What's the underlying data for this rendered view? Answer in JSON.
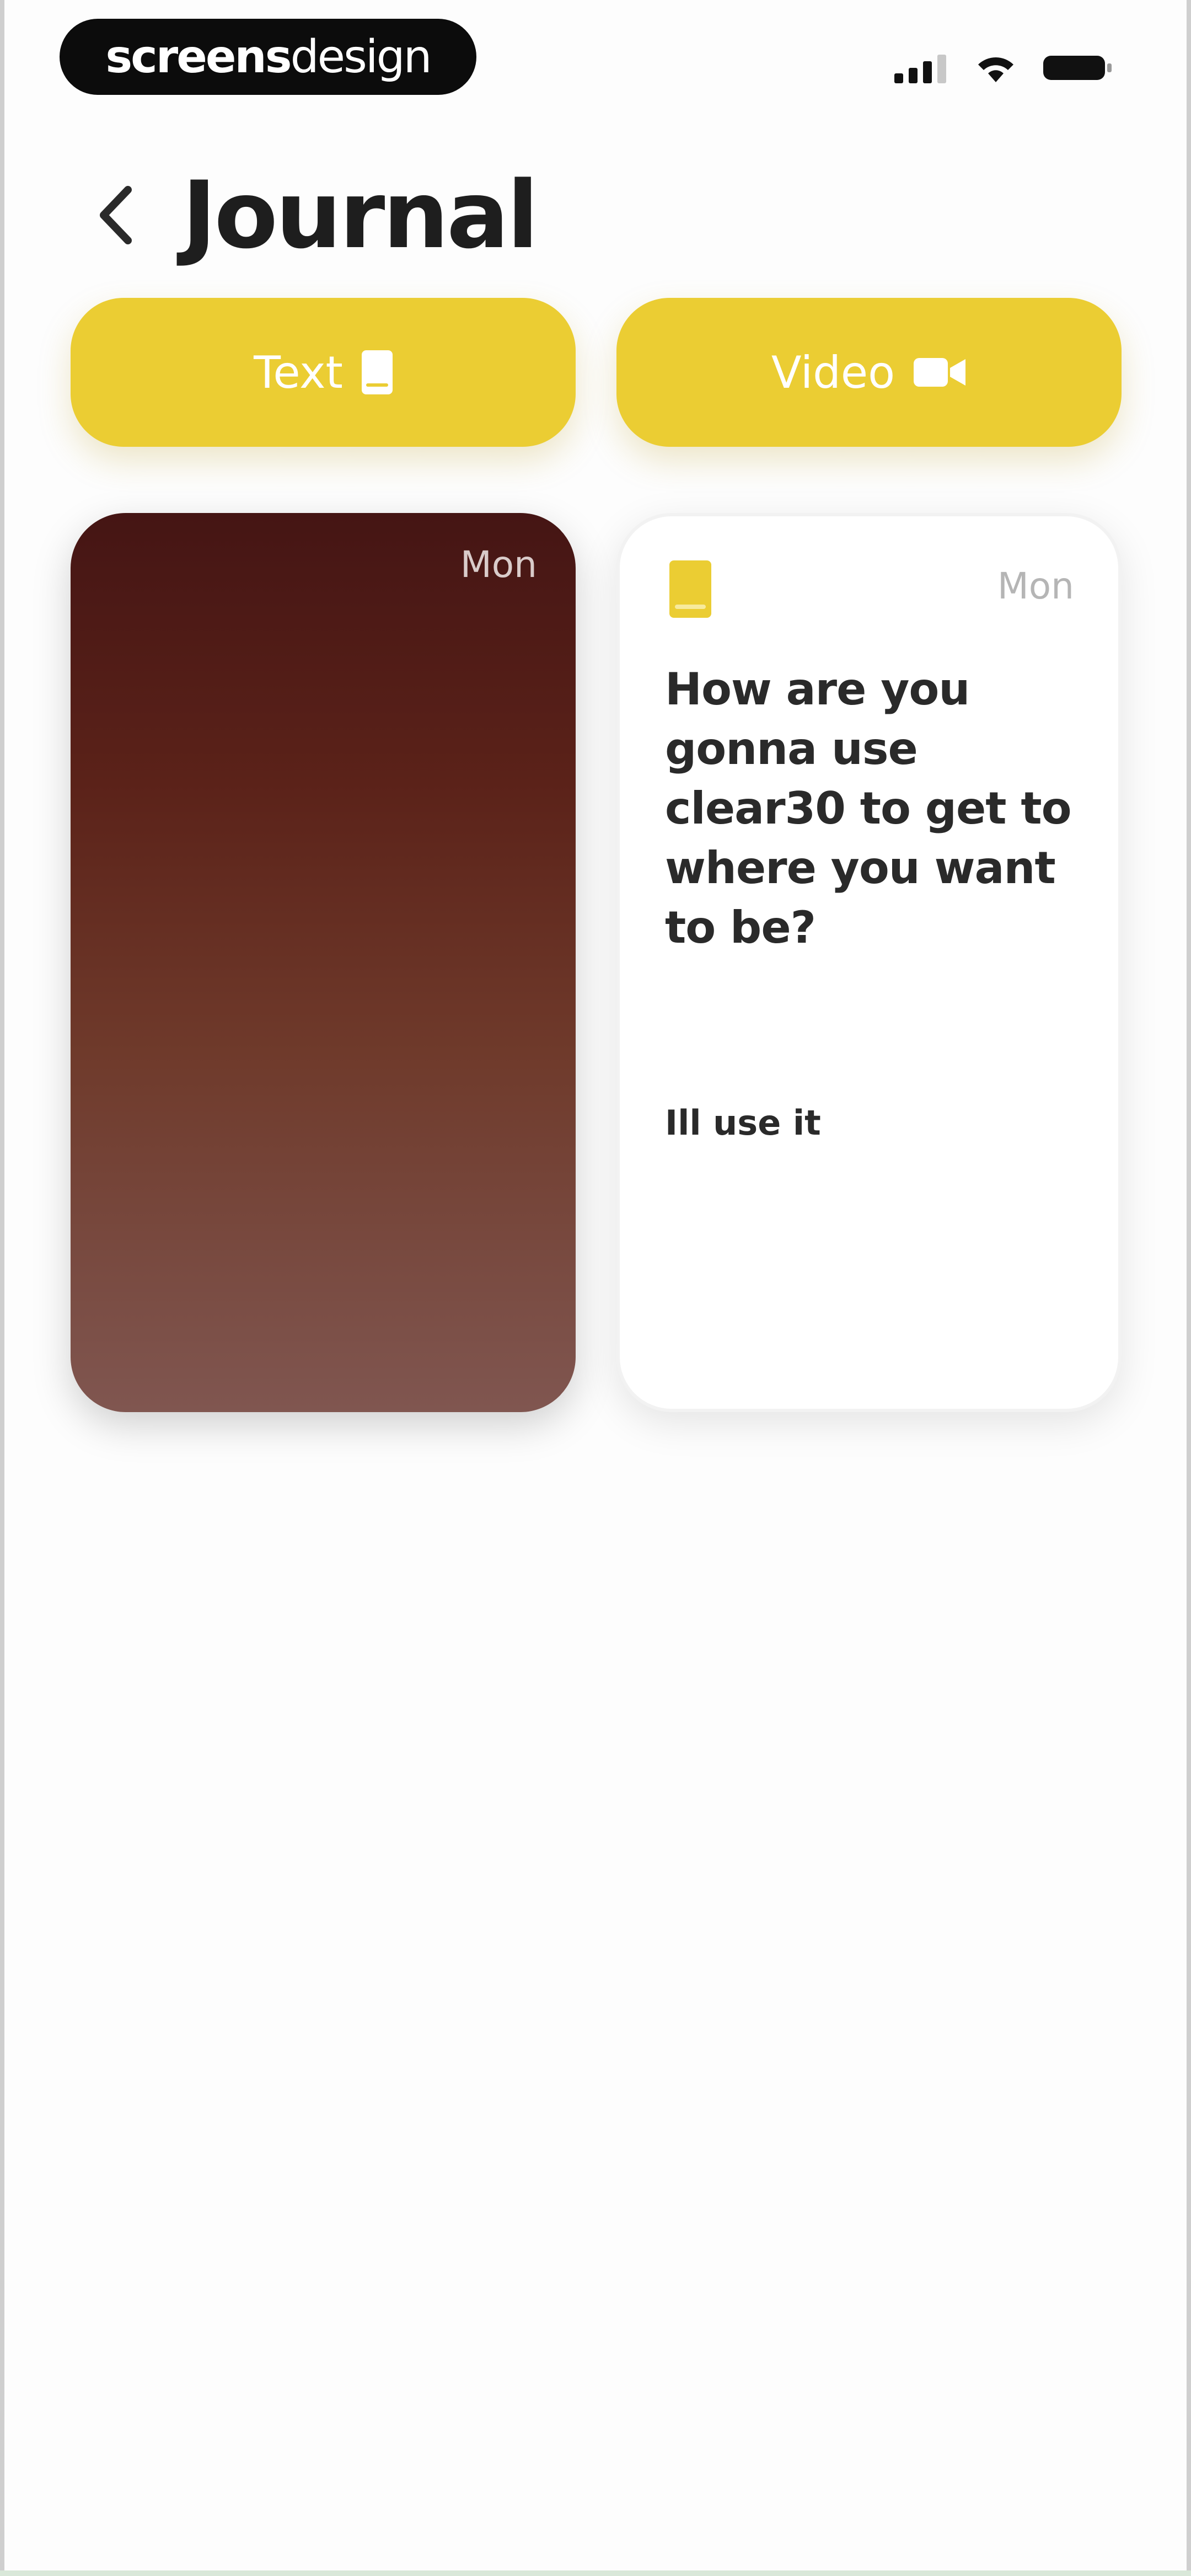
{
  "status_bar": {
    "brand_bold": "screens",
    "brand_light": "design",
    "icons": [
      "signal-icon",
      "wifi-icon",
      "battery-icon"
    ]
  },
  "header": {
    "title": "Journal",
    "back_icon": "chevron-left-icon"
  },
  "actions": [
    {
      "label": "Text",
      "icon": "note-icon"
    },
    {
      "label": "Video",
      "icon": "video-camera-icon"
    }
  ],
  "entries": [
    {
      "type": "video",
      "day": "Mon"
    },
    {
      "type": "text",
      "day": "Mon",
      "question": "How are you gonna use clear30 to get to where you want to be?",
      "answer": "Ill use it",
      "icon": "note-icon"
    }
  ],
  "colors": {
    "accent": "#EBCD33",
    "title": "#1E1E1E",
    "background": "#FDFDFD",
    "video_gradient_top": "#451514",
    "video_gradient_bottom": "#805650"
  }
}
